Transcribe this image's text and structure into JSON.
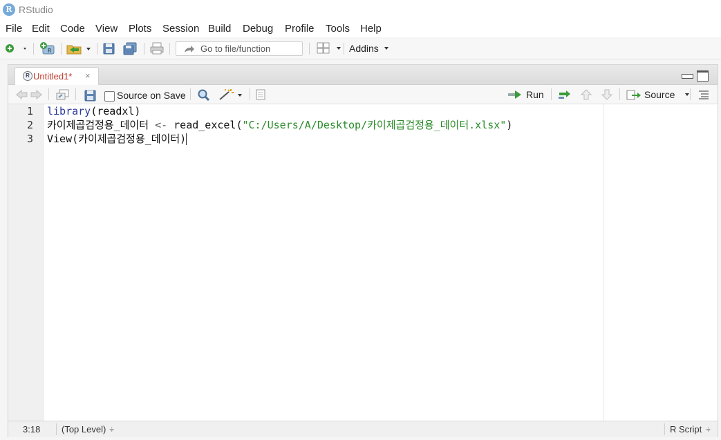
{
  "app": {
    "title": "RStudio",
    "logo_letter": "R"
  },
  "menu": [
    "File",
    "Edit",
    "Code",
    "View",
    "Plots",
    "Session",
    "Build",
    "Debug",
    "Profile",
    "Tools",
    "Help"
  ],
  "toolbar": {
    "goto_placeholder": "Go to file/function",
    "addins_label": "Addins"
  },
  "editor": {
    "tab_label": "Untitled1*",
    "tab_close": "×",
    "tab_icon_letter": "R",
    "source_on_save_label": "Source on Save",
    "run_label": "Run",
    "source_label": "Source",
    "lines": [
      {
        "num": "1",
        "tokens": [
          {
            "t": "library",
            "c": "kw"
          },
          {
            "t": "(readxl)",
            "c": "plain"
          }
        ]
      },
      {
        "num": "2",
        "tokens": [
          {
            "t": "카이제곱검정용_데이터 ",
            "c": "plain"
          },
          {
            "t": "<-",
            "c": "op"
          },
          {
            "t": " read_excel(",
            "c": "plain"
          },
          {
            "t": "\"C:/Users/A/Desktop/카이제곱검정용_데이터.xlsx\"",
            "c": "str"
          },
          {
            "t": ")",
            "c": "plain"
          }
        ]
      },
      {
        "num": "3",
        "tokens": [
          {
            "t": "View",
            "c": "plain"
          },
          {
            "t": "(카이제곱검정용_데이터)",
            "c": "plain"
          }
        ]
      }
    ]
  },
  "status": {
    "cursor": "3:18",
    "scope": "(Top Level)",
    "scope_arrows": "÷",
    "file_type": "R Script",
    "file_type_arrows": "÷"
  }
}
